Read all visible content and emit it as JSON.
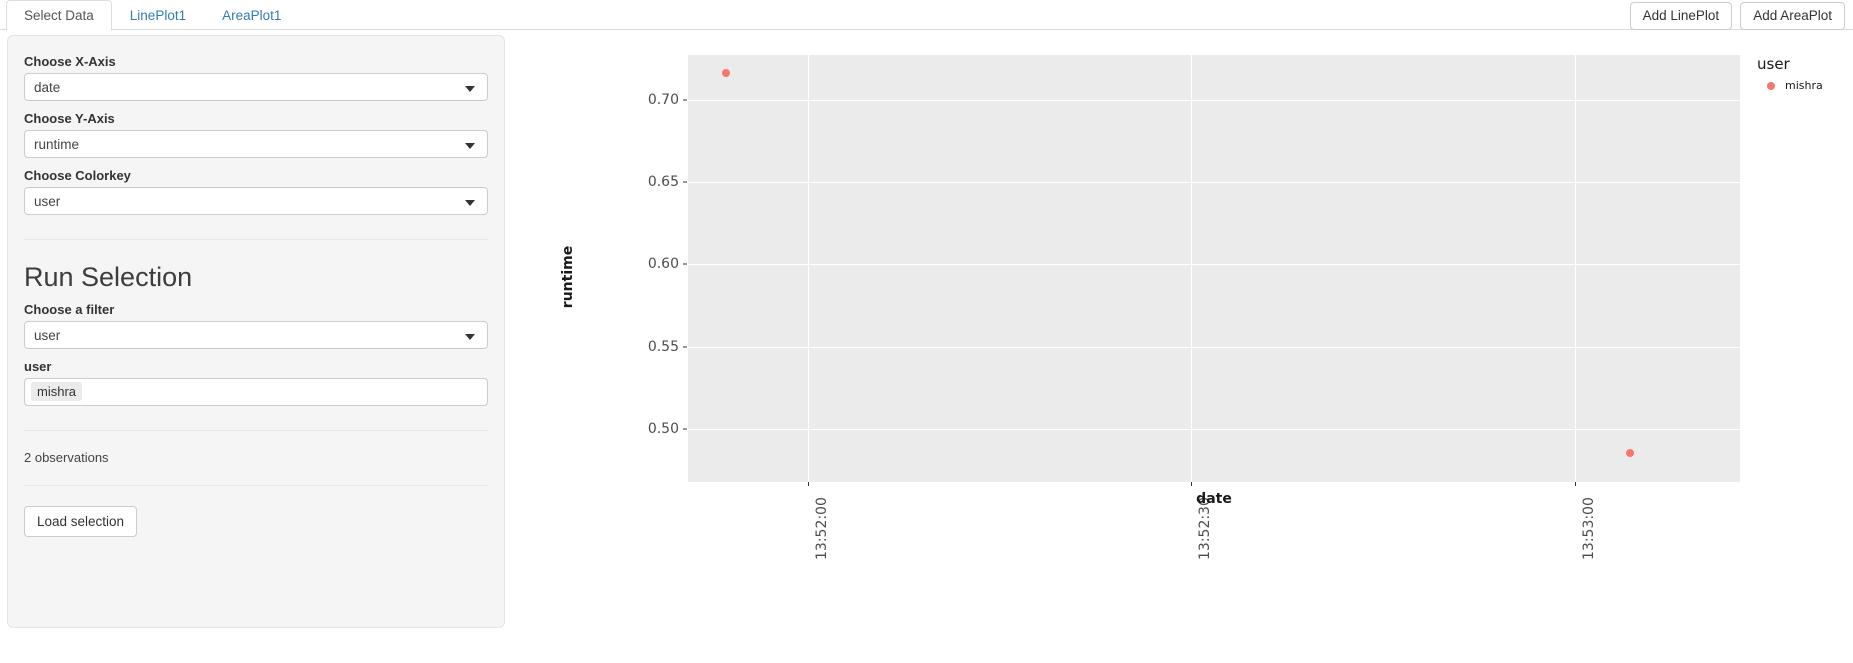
{
  "nav": {
    "tabs": [
      {
        "label": "Select Data",
        "active": true
      },
      {
        "label": "LinePlot1",
        "active": false
      },
      {
        "label": "AreaPlot1",
        "active": false
      }
    ],
    "actions": [
      {
        "label": "Add LinePlot"
      },
      {
        "label": "Add AreaPlot"
      }
    ]
  },
  "sidebar": {
    "x_axis": {
      "label": "Choose X-Axis",
      "value": "date"
    },
    "y_axis": {
      "label": "Choose Y-Axis",
      "value": "runtime"
    },
    "colorkey": {
      "label": "Choose Colorkey",
      "value": "user"
    },
    "run_selection": {
      "title": "Run Selection",
      "filter": {
        "label": "Choose a filter",
        "value": "user"
      },
      "user": {
        "label": "user",
        "token": "mishra"
      }
    },
    "observations": "2 observations",
    "load_button": "Load selection"
  },
  "chart_data": {
    "type": "scatter",
    "title": "",
    "xlabel": "date",
    "ylabel": "runtime",
    "accent_color": "#f8766d",
    "panel_color": "#ebebeb",
    "grid_color": "#ffffff",
    "grid": true,
    "legend": {
      "position": "right",
      "title": "user",
      "entries": [
        {
          "label": "mishra",
          "color": "#f8766d"
        }
      ]
    },
    "y_ticks": [
      0.5,
      0.55,
      0.6,
      0.65,
      0.7
    ],
    "y_tick_labels": [
      "0.50",
      "0.55",
      "0.60",
      "0.65",
      "0.70"
    ],
    "ylim": [
      0.468,
      0.727
    ],
    "x_ticks": [
      "13:52:00",
      "13:52:30",
      "13:53:00"
    ],
    "x_tick_positions": [
      0.114,
      0.478,
      0.843
    ],
    "series": [
      {
        "name": "mishra",
        "color": "#f8766d",
        "points": [
          {
            "x": "13:51:53",
            "y": 0.716,
            "px": 0.0365,
            "py": 0.716
          },
          {
            "x": "13:53:06",
            "y": 0.4855,
            "px": 0.8953,
            "py": 0.4855
          }
        ]
      }
    ]
  }
}
